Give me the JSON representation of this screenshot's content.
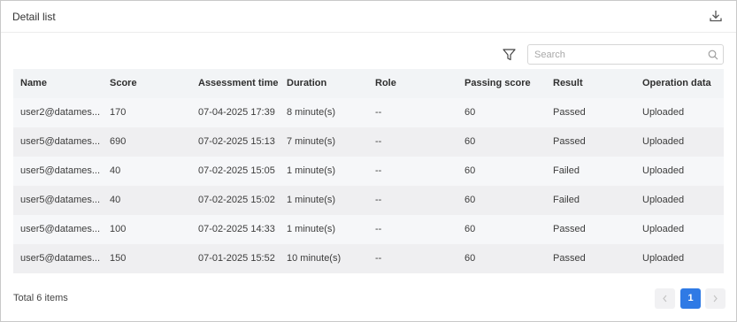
{
  "header": {
    "title": "Detail list",
    "download_icon": "download-icon"
  },
  "toolbar": {
    "filter_icon": "filter-icon",
    "search": {
      "placeholder": "Search",
      "value": "",
      "icon": "search-icon"
    }
  },
  "table": {
    "columns": [
      "Name",
      "Score",
      "Assessment time",
      "Duration",
      "Role",
      "Passing score",
      "Result",
      "Operation data"
    ],
    "rows": [
      [
        "user2@datames...",
        "170",
        "07-04-2025 17:39",
        "8 minute(s)",
        "--",
        "60",
        "Passed",
        "Uploaded"
      ],
      [
        "user5@datames...",
        "690",
        "07-02-2025 15:13",
        "7 minute(s)",
        "--",
        "60",
        "Passed",
        "Uploaded"
      ],
      [
        "user5@datames...",
        "40",
        "07-02-2025 15:05",
        "1 minute(s)",
        "--",
        "60",
        "Failed",
        "Uploaded"
      ],
      [
        "user5@datames...",
        "40",
        "07-02-2025 15:02",
        "1 minute(s)",
        "--",
        "60",
        "Failed",
        "Uploaded"
      ],
      [
        "user5@datames...",
        "100",
        "07-02-2025 14:33",
        "1 minute(s)",
        "--",
        "60",
        "Passed",
        "Uploaded"
      ],
      [
        "user5@datames...",
        "150",
        "07-01-2025 15:52",
        "10 minute(s)",
        "--",
        "60",
        "Passed",
        "Uploaded"
      ]
    ]
  },
  "footer": {
    "total": "Total 6 items",
    "pagination": {
      "current_page": "1",
      "prev_icon": "chevron-left-icon",
      "next_icon": "chevron-right-icon"
    }
  },
  "colors": {
    "accent": "#2f7ae5",
    "header_row_bg": "#f2f4f6",
    "row_bg_a": "#f6f7f9",
    "row_bg_b": "#efeff1"
  }
}
